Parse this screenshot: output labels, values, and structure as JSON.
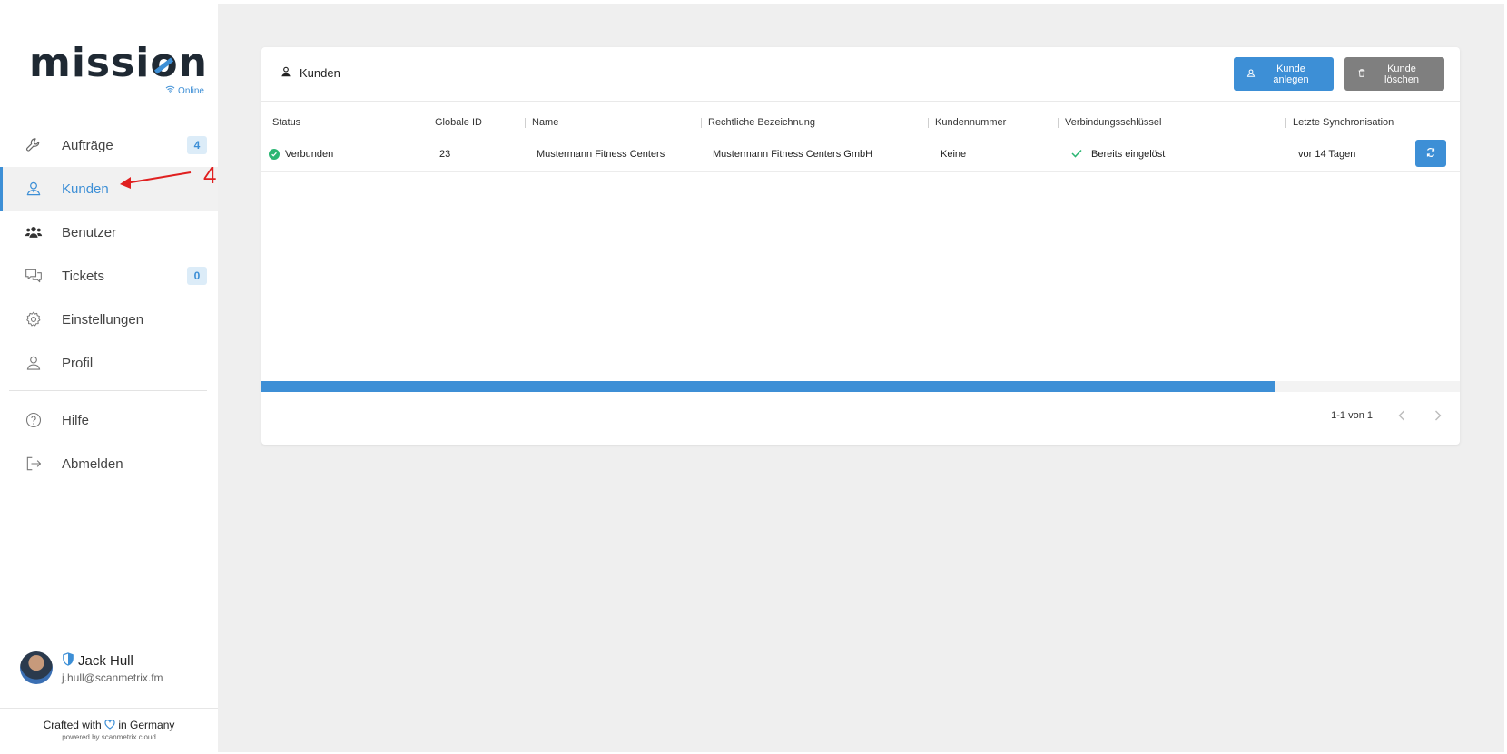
{
  "brand": {
    "name_part1": "missi",
    "name_o": "o",
    "name_part2": "n",
    "status": "Online"
  },
  "sidebar": {
    "items": [
      {
        "label": "Aufträge",
        "icon": "wrench-icon",
        "badge": "4"
      },
      {
        "label": "Kunden",
        "icon": "customer-icon",
        "active": true
      },
      {
        "label": "Benutzer",
        "icon": "users-icon"
      },
      {
        "label": "Tickets",
        "icon": "chat-icon",
        "badge": "0"
      },
      {
        "label": "Einstellungen",
        "icon": "gear-icon"
      },
      {
        "label": "Profil",
        "icon": "person-icon"
      }
    ],
    "secondary": [
      {
        "label": "Hilfe",
        "icon": "help-icon"
      },
      {
        "label": "Abmelden",
        "icon": "logout-icon"
      }
    ]
  },
  "annotation": {
    "number": "4",
    "color": "#e02020"
  },
  "user": {
    "name": "Jack Hull",
    "email": "j.hull@scanmetrix.fm"
  },
  "footer": {
    "line1_a": "Crafted with",
    "line1_b": "in Germany",
    "line2": "powered by scanmetrix cloud"
  },
  "card": {
    "title": "Kunden",
    "buttons": {
      "create": "Kunde anlegen",
      "delete": "Kunde löschen"
    },
    "columns": [
      "Status",
      "Globale ID",
      "Name",
      "Rechtliche Bezeichnung",
      "Kundennummer",
      "Verbindungsschlüssel",
      "Letzte Synchronisation"
    ],
    "rows": [
      {
        "status": "Verbunden",
        "global_id": "23",
        "name": "Mustermann Fitness Centers",
        "legal": "Mustermann Fitness Centers GmbH",
        "customer_no": "Keine",
        "key": "Bereits eingelöst",
        "last_sync": "vor 14 Tagen"
      }
    ],
    "pagination": "1-1 von 1"
  },
  "colors": {
    "accent": "#3d8fd6",
    "success": "#2bb673",
    "danger_button": "#7f7f7f",
    "background": "#efefef"
  }
}
